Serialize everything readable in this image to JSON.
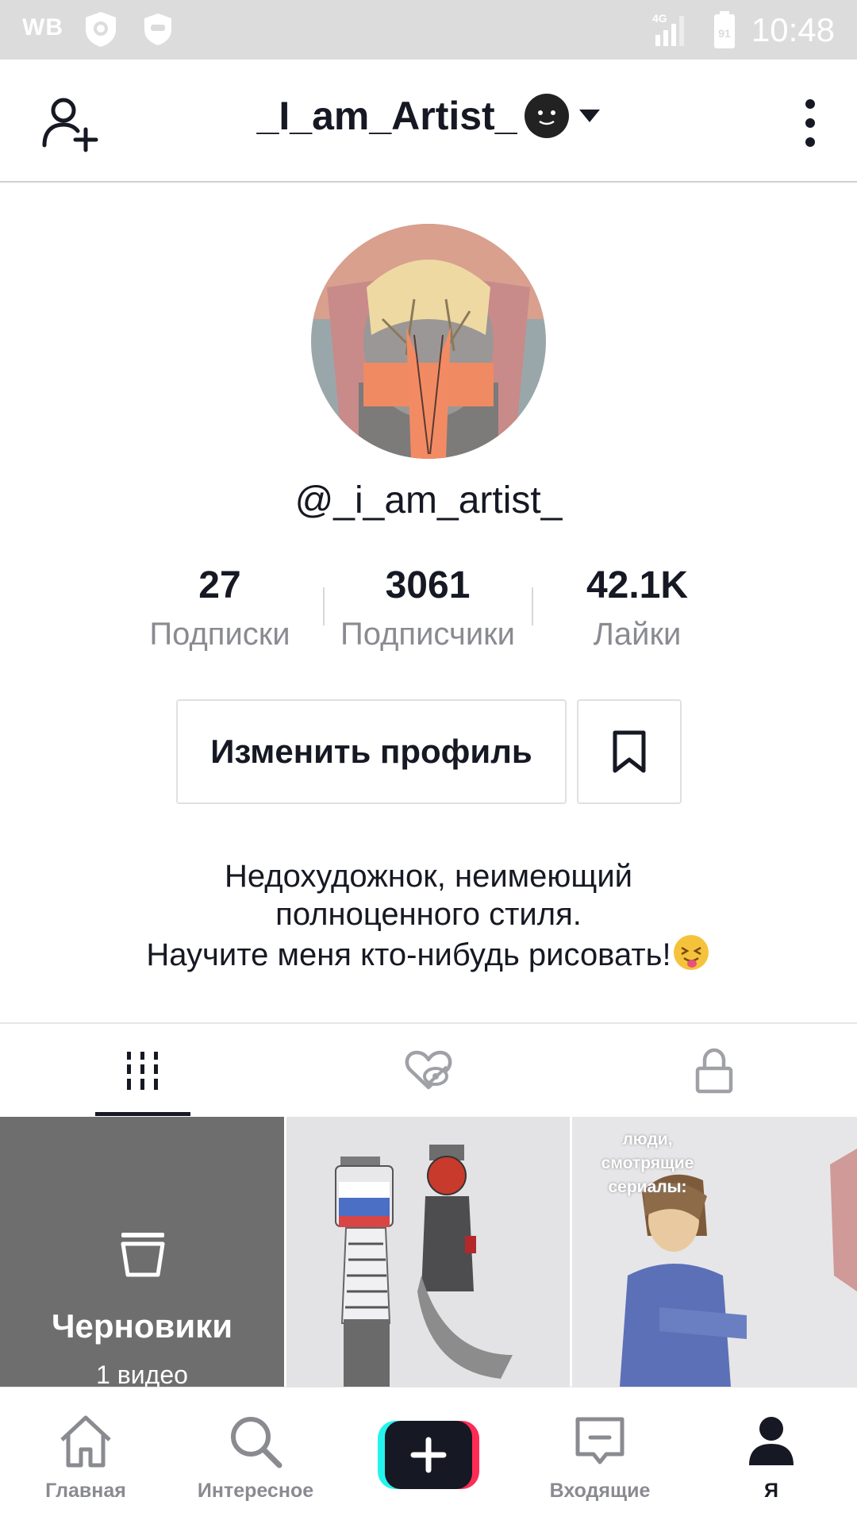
{
  "status_bar": {
    "carrier": "WB",
    "time": "10:48",
    "network": "4G",
    "battery": "91"
  },
  "header": {
    "title": "_I_am_Artist_"
  },
  "profile": {
    "username": "@_i_am_artist_",
    "stats": [
      {
        "value": "27",
        "label": "Подписки"
      },
      {
        "value": "3061",
        "label": "Подписчики"
      },
      {
        "value": "42.1K",
        "label": "Лайки"
      }
    ],
    "edit_button": "Изменить профиль",
    "bio": [
      "Недохудожнок, неимеющий",
      "полноценного стиля.",
      "Научите меня кто-нибудь рисовать!"
    ]
  },
  "grid": {
    "drafts_title": "Черновики",
    "drafts_count": "1 видео",
    "video2_overlay": "люди, смотрящие сериалы:"
  },
  "bottom_nav": {
    "items": [
      {
        "label": "Главная"
      },
      {
        "label": "Интересное"
      },
      {
        "label": "Входящие"
      },
      {
        "label": "Я"
      }
    ]
  },
  "colors": {
    "text": "#161823",
    "muted": "#8a8b91",
    "status_bar_bg": "#dcdcdc",
    "plus_cyan": "#25f4ee",
    "plus_red": "#fe2c55"
  }
}
